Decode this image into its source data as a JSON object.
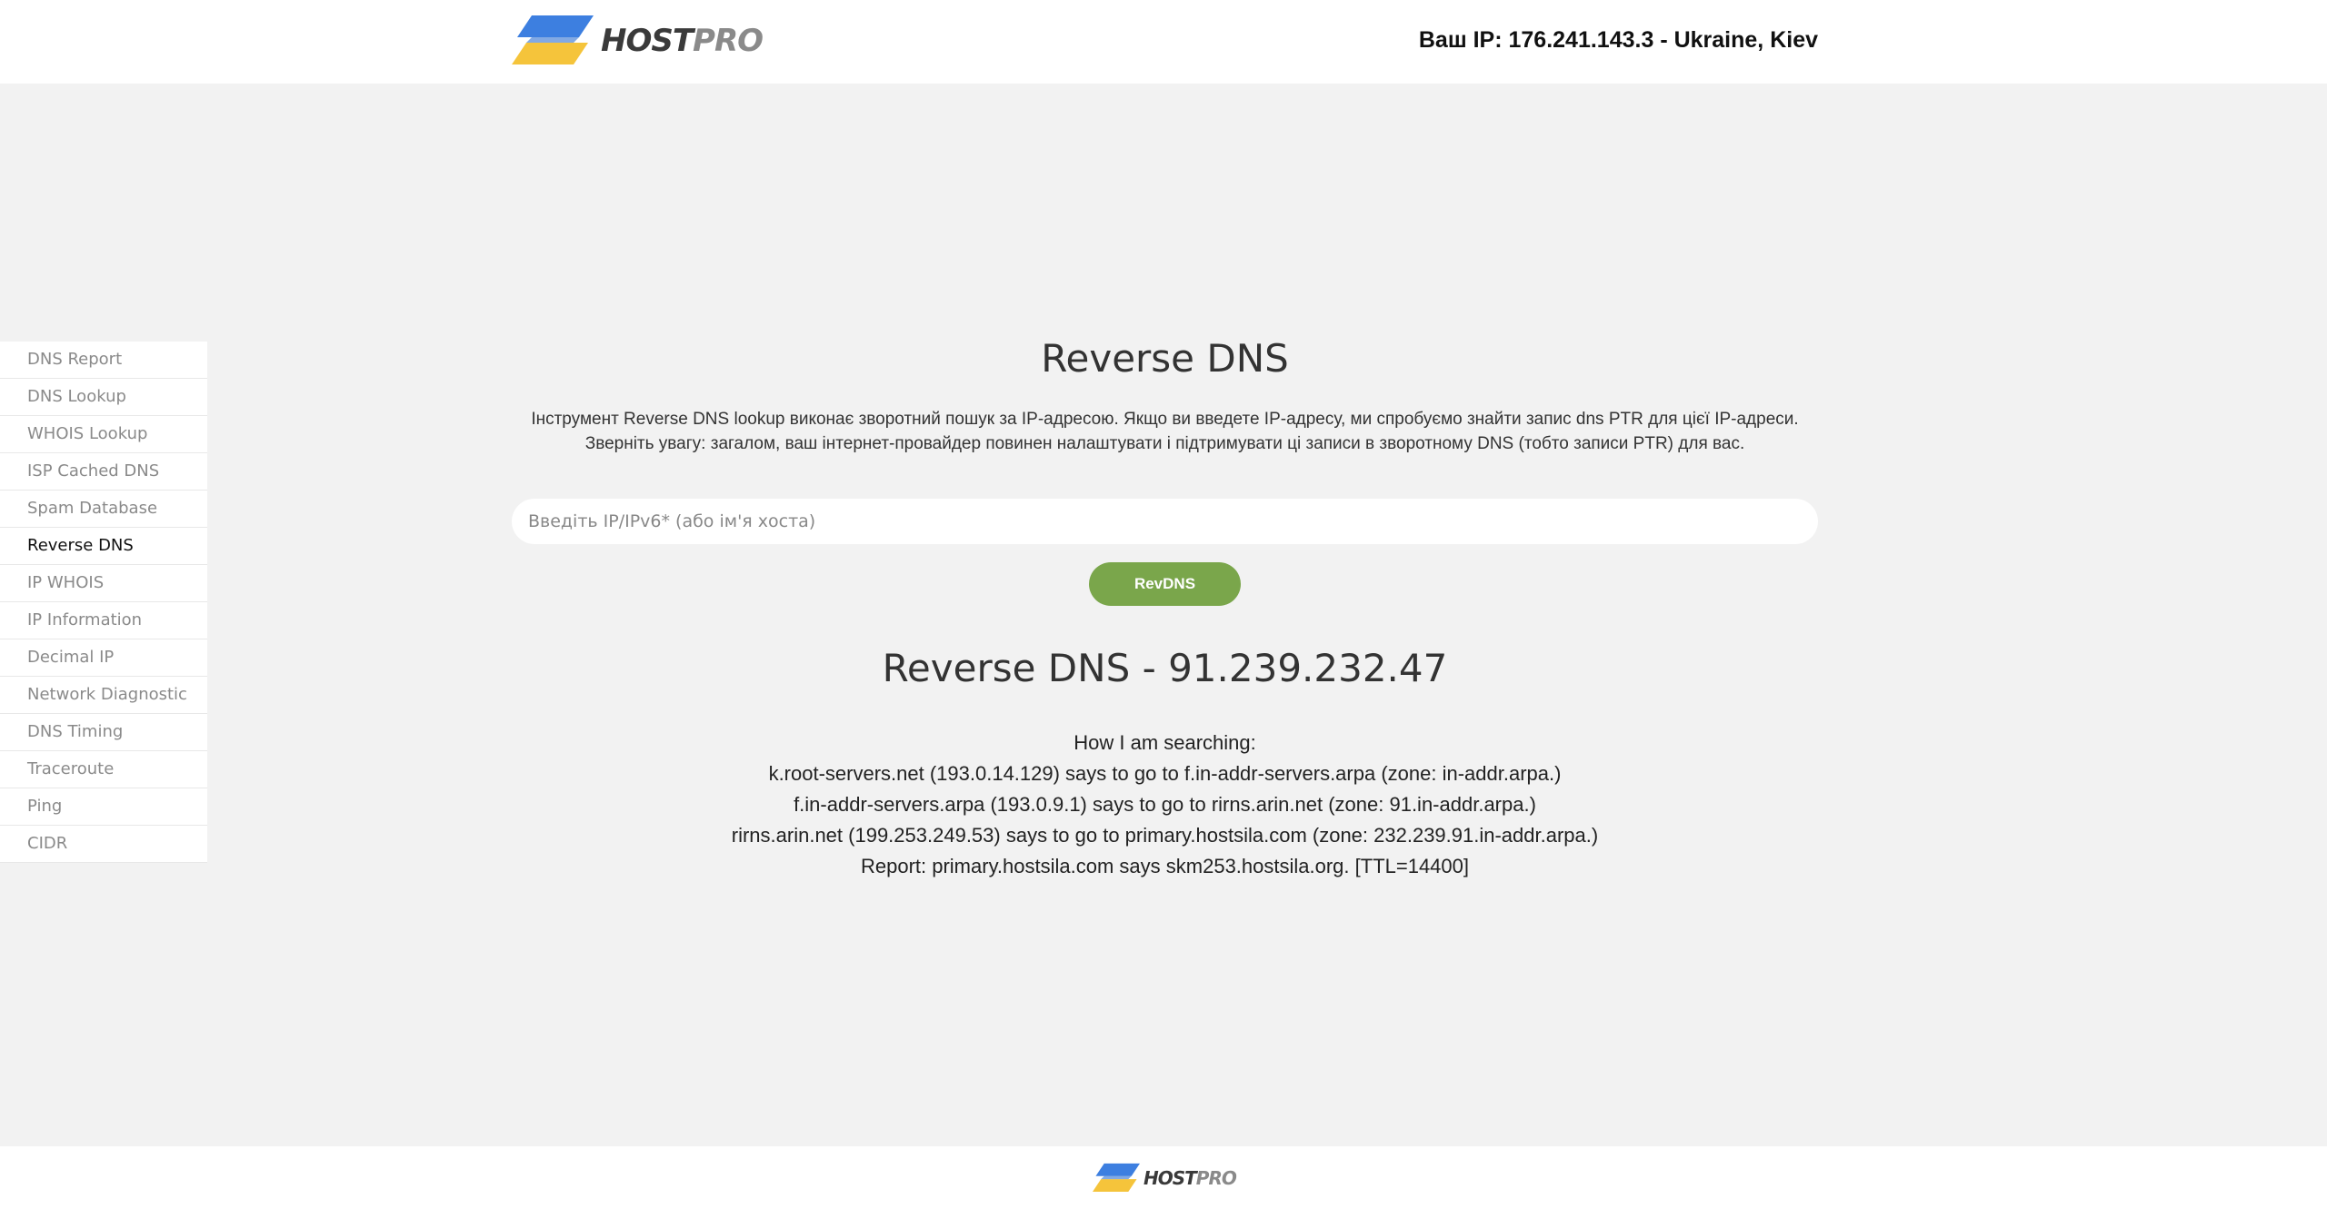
{
  "header": {
    "logo": {
      "host": "HOST",
      "pro": "PRO"
    },
    "ip_info": "Ваш IP: 176.241.143.3 - Ukraine, Kiev"
  },
  "sidebar": {
    "items": [
      {
        "label": "DNS Report"
      },
      {
        "label": "DNS Lookup"
      },
      {
        "label": "WHOIS Lookup"
      },
      {
        "label": "ISP Cached DNS"
      },
      {
        "label": "Spam Database"
      },
      {
        "label": "Reverse DNS"
      },
      {
        "label": "IP WHOIS"
      },
      {
        "label": "IP Information"
      },
      {
        "label": "Decimal IP"
      },
      {
        "label": "Network Diagnostic"
      },
      {
        "label": "DNS Timing"
      },
      {
        "label": "Traceroute"
      },
      {
        "label": "Ping"
      },
      {
        "label": "CIDR"
      }
    ],
    "active": "Reverse DNS"
  },
  "main": {
    "title": "Reverse DNS",
    "description_lines": [
      "Інструмент Reverse DNS lookup виконає зворотний пошук за IP-адресою. Якщо ви введете IP-адресу, ми спробуємо знайти запис dns PTR для цієї IP-адреси.",
      "Зверніть увагу: загалом, ваш інтернет-провайдер повинен налаштувати і підтримувати ці записи в зворотному DNS (тобто записи PTR) для вас."
    ],
    "search": {
      "placeholder": "Введіть IP/IPv6* (або ім'я хоста)",
      "value": ""
    },
    "button_label": "RevDNS",
    "result_title": "Reverse DNS - 91.239.232.47",
    "result_lines": [
      "How I am searching:",
      "k.root-servers.net (193.0.14.129) says to go to f.in-addr-servers.arpa (zone: in-addr.arpa.)",
      "f.in-addr-servers.arpa (193.0.9.1) says to go to rirns.arin.net (zone: 91.in-addr.arpa.)",
      "rirns.arin.net (199.253.249.53) says to go to primary.hostsila.com (zone: 232.239.91.in-addr.arpa.)",
      "Report: primary.hostsila.com says skm253.hostsila.org. [TTL=14400]"
    ]
  },
  "footer": {
    "logo": {
      "host": "HOST",
      "pro": "PRO"
    }
  },
  "colors": {
    "accent_green": "#7aa64b",
    "logo_blue": "#3d7fe0",
    "logo_yellow": "#f5c43b",
    "page_bg": "#f2f2f2"
  }
}
